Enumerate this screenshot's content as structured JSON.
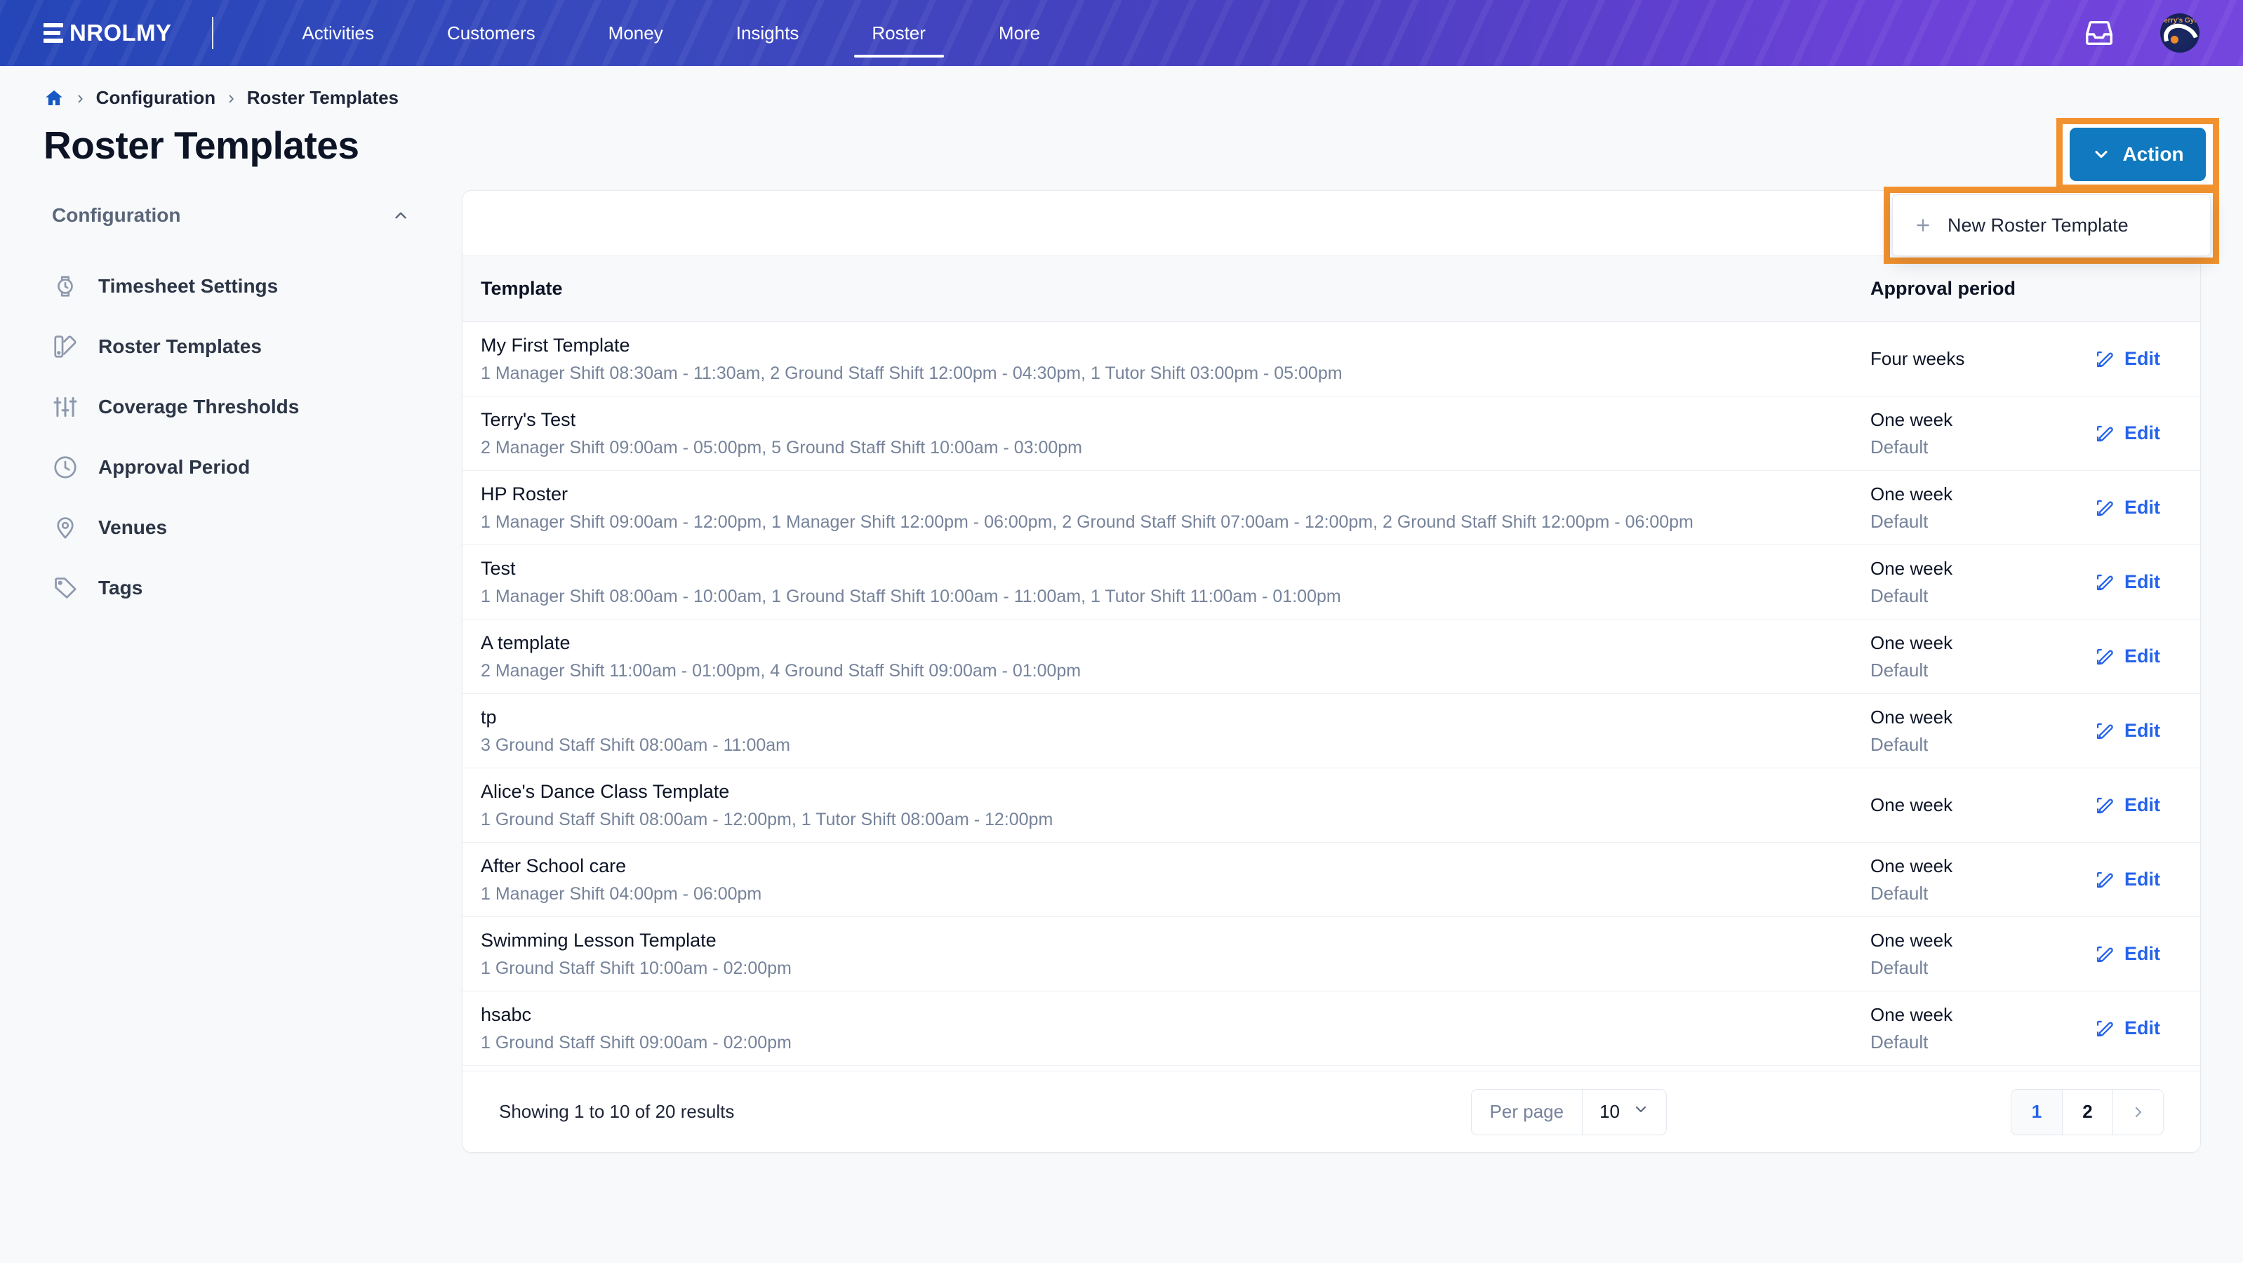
{
  "nav": {
    "logo_text": "NROLMY",
    "items": [
      {
        "label": "Activities",
        "active": false
      },
      {
        "label": "Customers",
        "active": false
      },
      {
        "label": "Money",
        "active": false
      },
      {
        "label": "Insights",
        "active": false
      },
      {
        "label": "Roster",
        "active": true
      },
      {
        "label": "More",
        "active": false
      }
    ],
    "inbox_icon": "inbox-icon",
    "avatar_label": "Terry's Gym"
  },
  "breadcrumb": {
    "home_icon": "home-icon",
    "separator": "›",
    "items": [
      "Configuration",
      "Roster Templates"
    ]
  },
  "page_title": "Roster Templates",
  "action": {
    "label": "Action",
    "chevron_icon": "chevron-down-icon",
    "accent_color": "#1179bf",
    "highlight_color": "#f2922e",
    "menu": [
      {
        "label": "New Roster Template",
        "icon": "plus-icon"
      }
    ]
  },
  "sidebar": {
    "heading": "Configuration",
    "collapse_icon": "chevron-up-icon",
    "items": [
      {
        "label": "Timesheet Settings",
        "icon": "watch-icon"
      },
      {
        "label": "Roster Templates",
        "icon": "palette-icon"
      },
      {
        "label": "Coverage Thresholds",
        "icon": "sliders-icon"
      },
      {
        "label": "Approval Period",
        "icon": "clock-icon"
      },
      {
        "label": "Venues",
        "icon": "location-pin-icon"
      },
      {
        "label": "Tags",
        "icon": "tag-icon"
      }
    ]
  },
  "table": {
    "columns": [
      "Template",
      "Approval period",
      ""
    ],
    "edit_label": "Edit",
    "edit_icon": "edit-pencil-icon",
    "rows": [
      {
        "name": "My First Template",
        "shifts": "1 Manager Shift 08:30am - 11:30am, 2 Ground Staff Shift 12:00pm - 04:30pm, 1 Tutor Shift 03:00pm - 05:00pm",
        "approval": "Four weeks",
        "approval_sub": ""
      },
      {
        "name": "Terry's Test",
        "shifts": "2 Manager Shift 09:00am - 05:00pm, 5 Ground Staff Shift 10:00am - 03:00pm",
        "approval": "One week",
        "approval_sub": "Default"
      },
      {
        "name": "HP Roster",
        "shifts": "1 Manager Shift 09:00am - 12:00pm, 1 Manager Shift 12:00pm - 06:00pm, 2 Ground Staff Shift 07:00am - 12:00pm, 2 Ground Staff Shift 12:00pm - 06:00pm",
        "approval": "One week",
        "approval_sub": "Default"
      },
      {
        "name": "Test",
        "shifts": "1 Manager Shift 08:00am - 10:00am, 1 Ground Staff Shift 10:00am - 11:00am, 1 Tutor Shift 11:00am - 01:00pm",
        "approval": "One week",
        "approval_sub": "Default"
      },
      {
        "name": "A template",
        "shifts": "2 Manager Shift 11:00am - 01:00pm, 4 Ground Staff Shift 09:00am - 01:00pm",
        "approval": "One week",
        "approval_sub": "Default"
      },
      {
        "name": "tp",
        "shifts": "3 Ground Staff Shift 08:00am - 11:00am",
        "approval": "One week",
        "approval_sub": "Default"
      },
      {
        "name": "Alice's Dance Class Template",
        "shifts": "1 Ground Staff Shift 08:00am - 12:00pm, 1 Tutor Shift 08:00am - 12:00pm",
        "approval": "One week",
        "approval_sub": ""
      },
      {
        "name": "After School care",
        "shifts": "1 Manager Shift 04:00pm - 06:00pm",
        "approval": "One week",
        "approval_sub": "Default"
      },
      {
        "name": "Swimming Lesson Template",
        "shifts": "1 Ground Staff Shift 10:00am - 02:00pm",
        "approval": "One week",
        "approval_sub": "Default"
      },
      {
        "name": "hsabc",
        "shifts": "1 Ground Staff Shift 09:00am - 02:00pm",
        "approval": "One week",
        "approval_sub": "Default"
      }
    ]
  },
  "pagination": {
    "info": "Showing 1 to 10 of 20 results",
    "per_page_label": "Per page",
    "per_page_value": "10",
    "per_page_chevron": "chevron-down-icon",
    "pages": [
      "1",
      "2"
    ],
    "next_icon": "chevron-right-icon",
    "current_page": "1"
  }
}
